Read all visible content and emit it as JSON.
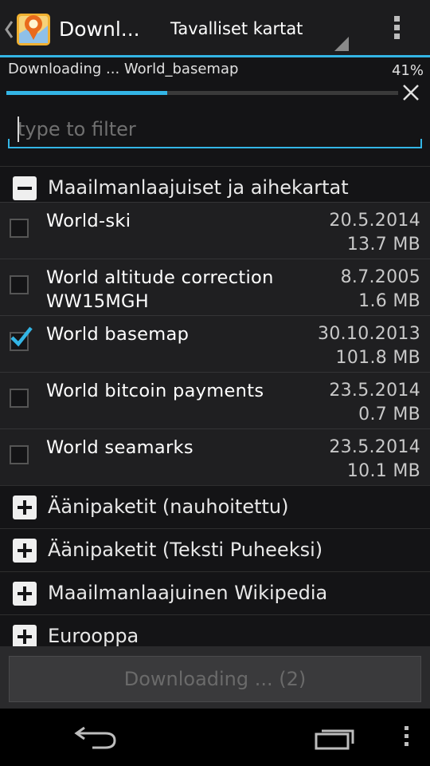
{
  "colors": {
    "accent": "#33b5e5",
    "background": "#141416",
    "item_background": "#1f1f21"
  },
  "action_bar": {
    "title": "Downl...",
    "spinner_selected": "Tavalliset kartat",
    "app_icon": "osmand-map-icon",
    "overflow_icon": "overflow-menu-icon"
  },
  "download": {
    "status": "Downloading ... World_basemap",
    "percent_label": "41%",
    "progress": 0.41,
    "cancel_icon": "close-icon"
  },
  "filter": {
    "placeholder": "type to filter",
    "value": ""
  },
  "expanded_group": {
    "label": "Maailmanlaajuiset ja aihekartat",
    "items": [
      {
        "name": "World-ski",
        "date": "20.5.2014",
        "size": "13.7 MB",
        "checked": false
      },
      {
        "name": "World altitude correction WW15MGH",
        "date": "8.7.2005",
        "size": "1.6 MB",
        "checked": false
      },
      {
        "name": "World basemap",
        "date": "30.10.2013",
        "size": "101.8 MB",
        "checked": true
      },
      {
        "name": "World bitcoin payments",
        "date": "23.5.2014",
        "size": "0.7 MB",
        "checked": false
      },
      {
        "name": "World seamarks",
        "date": "23.5.2014",
        "size": "10.1 MB",
        "checked": false
      }
    ]
  },
  "collapsed_groups": [
    {
      "label": "Äänipaketit (nauhoitettu)"
    },
    {
      "label": "Äänipaketit (Teksti Puheeksi)"
    },
    {
      "label": "Maailmanlaajuinen Wikipedia"
    },
    {
      "label": "Eurooppa"
    }
  ],
  "bottom_button": {
    "label": "Downloading ...  (2)"
  },
  "navbar": {
    "back_icon": "back-icon",
    "recent_icon": "recent-apps-icon",
    "menu_icon": "menu-icon"
  }
}
